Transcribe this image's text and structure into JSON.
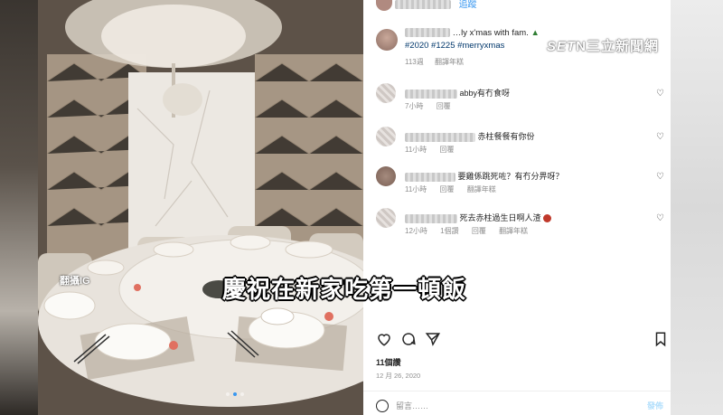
{
  "post": {
    "header_follow": "追蹤",
    "caption_text": "…ly x'mas with fam.",
    "hashtags": "#2020 #1225 #merryxmas",
    "caption_time": "113週",
    "caption_translate": "翻譯年糕"
  },
  "comments": [
    {
      "text": "abby有冇食呀",
      "time": "7小時",
      "reply": "回覆",
      "translate": ""
    },
    {
      "text": "赤柱餐餐有你份",
      "time": "11小時",
      "reply": "回覆",
      "translate": ""
    },
    {
      "text": "要雞係跳死咗？有冇分畀呀？",
      "time": "11小時",
      "reply": "回覆",
      "translate": "翻譯年糕"
    },
    {
      "text": "死去赤柱過生日啊人渣",
      "time": "12小時",
      "likes": "1個讚",
      "reply": "回覆",
      "translate": "翻譯年糕"
    }
  ],
  "footer": {
    "likes": "11個讚",
    "date": "12 月 26, 2020",
    "comment_placeholder": "留言……",
    "post_button": "發佈"
  },
  "overlay": {
    "logo_set": "SET",
    "logo_rest": "N三立新聞網",
    "source": "翻攝IG",
    "subtitle": "慶祝在新家吃第一頓飯"
  },
  "icons": {
    "heart": "heart-icon",
    "comment": "comment-icon",
    "share": "share-icon",
    "save": "bookmark-icon",
    "emoji": "smile-icon",
    "next": "chevron-right-icon"
  }
}
